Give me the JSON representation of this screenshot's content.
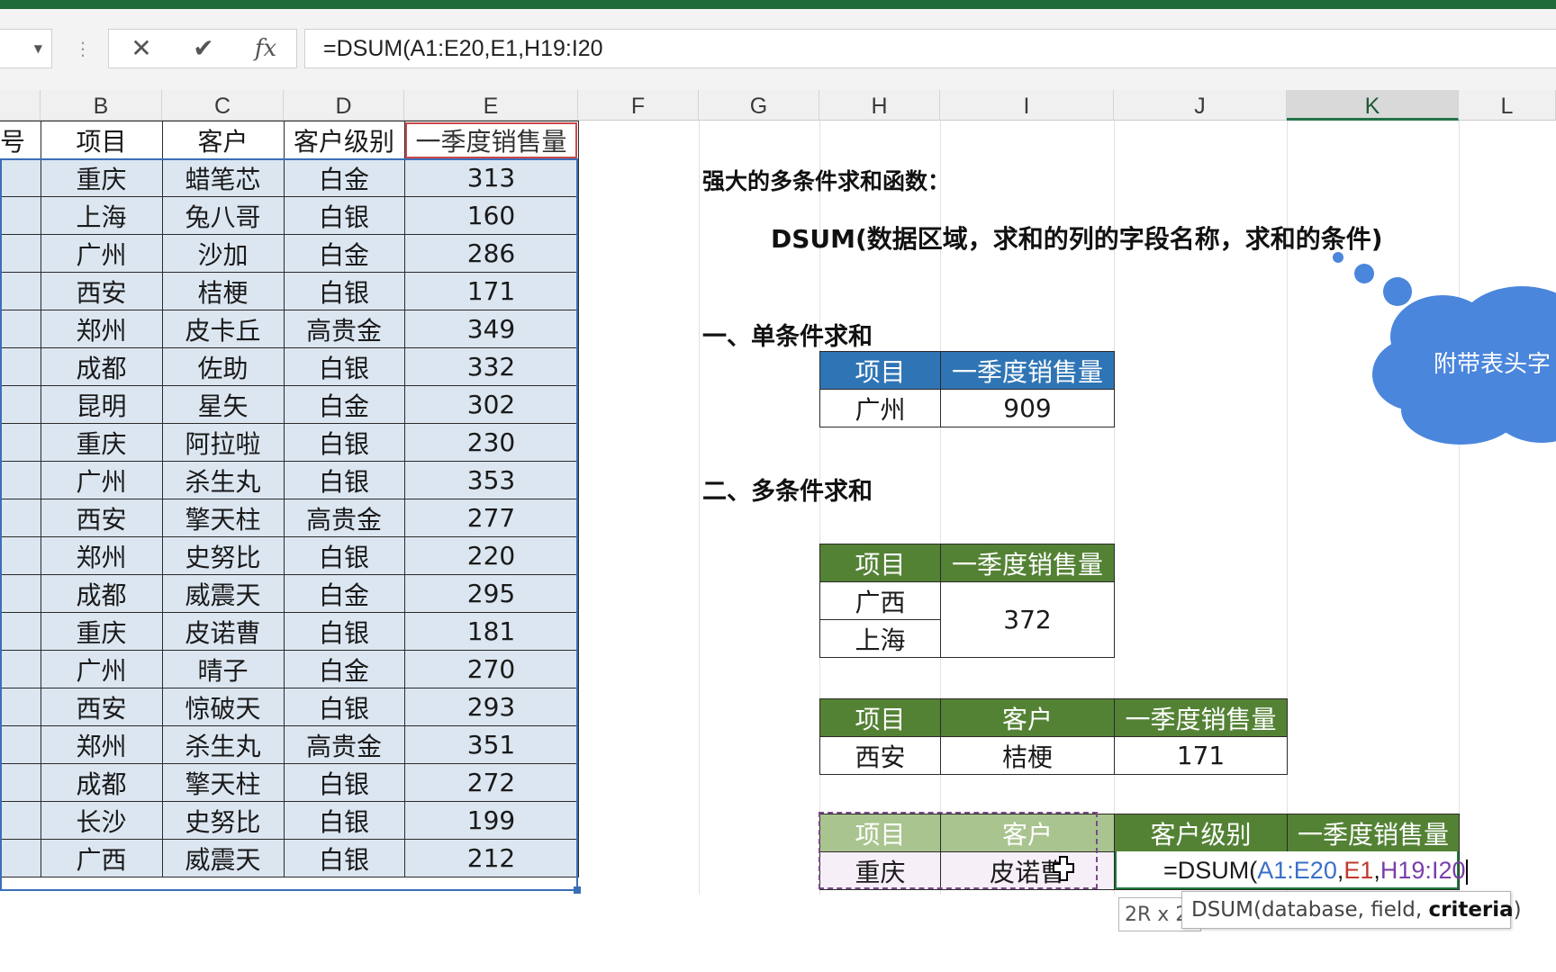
{
  "formula_bar": {
    "name_box": "",
    "cancel_glyph": "✕",
    "enter_glyph": "✔",
    "fx_glyph": "fx",
    "formula": "=DSUM(A1:E20,E1,H19:I20"
  },
  "columns": [
    "B",
    "C",
    "D",
    "E",
    "F",
    "G",
    "H",
    "I",
    "J",
    "K",
    "L"
  ],
  "selected_column": "K",
  "data_table": {
    "first_header_fragment": "号",
    "headers": [
      "项目",
      "客户",
      "客户级别",
      "一季度销售量"
    ],
    "rows": [
      [
        "重庆",
        "蜡笔芯",
        "白金",
        "313"
      ],
      [
        "上海",
        "兔八哥",
        "白银",
        "160"
      ],
      [
        "广州",
        "沙加",
        "白金",
        "286"
      ],
      [
        "西安",
        "桔梗",
        "白银",
        "171"
      ],
      [
        "郑州",
        "皮卡丘",
        "高贵金",
        "349"
      ],
      [
        "成都",
        "佐助",
        "白银",
        "332"
      ],
      [
        "昆明",
        "星矢",
        "白金",
        "302"
      ],
      [
        "重庆",
        "阿拉啦",
        "白银",
        "230"
      ],
      [
        "广州",
        "杀生丸",
        "白银",
        "353"
      ],
      [
        "西安",
        "擎天柱",
        "高贵金",
        "277"
      ],
      [
        "郑州",
        "史努比",
        "白银",
        "220"
      ],
      [
        "成都",
        "威震天",
        "白金",
        "295"
      ],
      [
        "重庆",
        "皮诺曹",
        "白银",
        "181"
      ],
      [
        "广州",
        "晴子",
        "白金",
        "270"
      ],
      [
        "西安",
        "惊破天",
        "白银",
        "293"
      ],
      [
        "郑州",
        "杀生丸",
        "高贵金",
        "351"
      ],
      [
        "成都",
        "擎天柱",
        "白银",
        "272"
      ],
      [
        "长沙",
        "史努比",
        "白银",
        "199"
      ],
      [
        "广西",
        "威震天",
        "白银",
        "212"
      ]
    ]
  },
  "notes": {
    "title": "强大的多条件求和函数：",
    "syntax": "DSUM(数据区域，求和的列的字段名称，求和的条件)",
    "section1": "一、单条件求和",
    "section2": "二、多条件求和",
    "cloud_text": "附带表头字"
  },
  "single_table": {
    "headers": [
      "项目",
      "一季度销售量"
    ],
    "values": [
      "广州",
      "909"
    ]
  },
  "multi_table1": {
    "headers": [
      "项目",
      "一季度销售量"
    ],
    "rows": [
      "广西",
      "上海"
    ],
    "result": "372"
  },
  "multi_table2": {
    "headers": [
      "项目",
      "客户",
      "一季度销售量"
    ],
    "values": [
      "西安",
      "桔梗",
      "171"
    ]
  },
  "multi_table3": {
    "headers": [
      "项目",
      "客户",
      "客户级别",
      "一季度销售量"
    ],
    "values": [
      "重庆",
      "皮诺曹"
    ],
    "editing": {
      "eq": "=DSUM(",
      "arg1": "A1:E20",
      "sep1": ",",
      "arg2": "E1",
      "sep2": ",",
      "arg3": "H19:I20"
    }
  },
  "tooltips": {
    "range_size": "2R x 2C",
    "function_hint_prefix": "DSUM(database, field, ",
    "function_hint_bold": "criteria",
    "function_hint_suffix": ")"
  },
  "colors": {
    "blue_header": "#2f75b5",
    "green_header": "#548235",
    "data_fill": "#dce6f1",
    "bubble": "#4a86dc",
    "accent_green": "#217346"
  }
}
